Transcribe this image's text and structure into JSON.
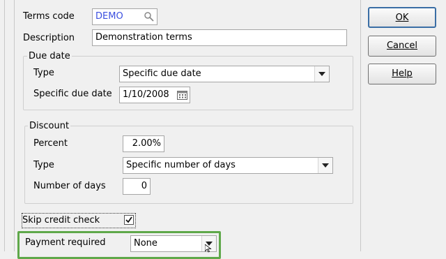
{
  "terms_code": {
    "label": "Terms code",
    "value": "DEMO"
  },
  "description": {
    "label": "Description",
    "value": "Demonstration terms"
  },
  "due_date": {
    "legend": "Due date",
    "type_label": "Type",
    "type_value": "Specific due date",
    "specific_label": "Specific due date",
    "specific_value": "1/10/2008"
  },
  "discount": {
    "legend": "Discount",
    "percent_label": "Percent",
    "percent_value": "2.00%",
    "type_label": "Type",
    "type_value": "Specific number of days",
    "days_label": "Number of days",
    "days_value": "0"
  },
  "skip_credit": {
    "label": "Skip credit check",
    "checked": true
  },
  "payment": {
    "label": "Payment required",
    "value": "None"
  },
  "buttons": {
    "ok": "OK",
    "cancel": "Cancel",
    "help": "Help"
  },
  "colors": {
    "highlight_border": "#5fa84a",
    "code_text": "#3b4fe0"
  }
}
